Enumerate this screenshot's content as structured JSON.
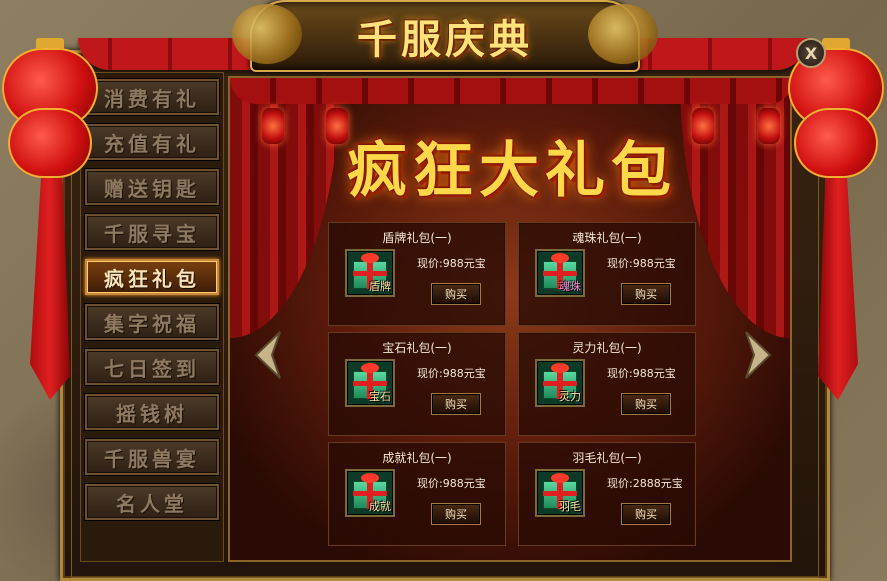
{
  "title": "千服庆典",
  "close_label": "X",
  "banner": "疯狂大礼包",
  "sidebar": {
    "items": [
      {
        "label": "消费有礼"
      },
      {
        "label": "充值有礼"
      },
      {
        "label": "赠送钥匙"
      },
      {
        "label": "千服寻宝"
      },
      {
        "label": "疯狂礼包",
        "active": true
      },
      {
        "label": "集字祝福"
      },
      {
        "label": "七日签到"
      },
      {
        "label": "摇钱树"
      },
      {
        "label": "千服兽宴"
      },
      {
        "label": "名人堂"
      }
    ]
  },
  "packages": [
    {
      "name": "盾牌礼包(一)",
      "tag": "盾牌",
      "price": "现价:988元宝",
      "buy": "购买"
    },
    {
      "name": "魂珠礼包(一)",
      "tag": "魂珠",
      "price": "现价:988元宝",
      "buy": "购买"
    },
    {
      "name": "宝石礼包(一)",
      "tag": "宝石",
      "price": "现价:988元宝",
      "buy": "购买"
    },
    {
      "name": "灵力礼包(一)",
      "tag": "灵力",
      "price": "现价:988元宝",
      "buy": "购买"
    },
    {
      "name": "成就礼包(一)",
      "tag": "成就",
      "price": "现价:988元宝",
      "buy": "购买"
    },
    {
      "name": "羽毛礼包(一)",
      "tag": "羽毛",
      "price": "现价:2888元宝",
      "buy": "购买"
    }
  ],
  "colors": {
    "accent": "#ffd84a",
    "active_tab": "#7a4010",
    "curtain_red": "#b81818"
  }
}
